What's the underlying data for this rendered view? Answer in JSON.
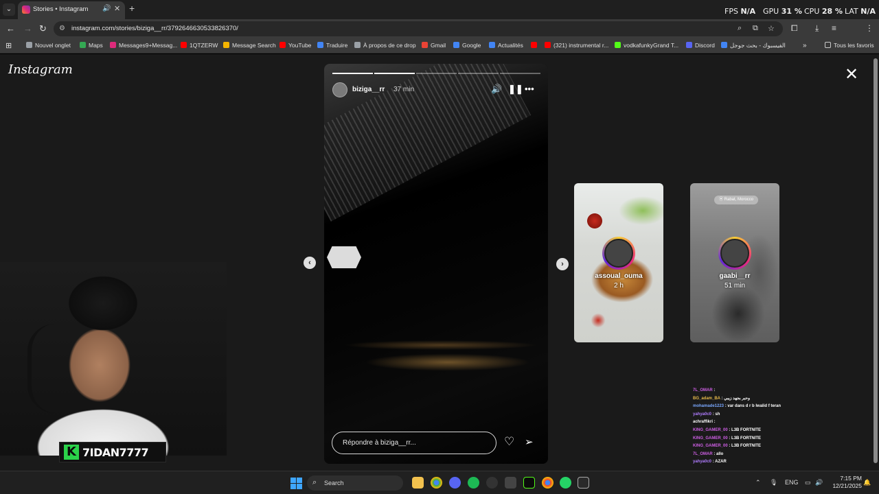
{
  "browser": {
    "tab": {
      "title": "Stories • Instagram"
    },
    "url": "instagram.com/stories/biziga__rr/3792646630533826370/",
    "bookmarks": [
      {
        "label": "Nouvel onglet",
        "icon": "globe-icon",
        "color": "#9aa0a6"
      },
      {
        "label": "Maps",
        "icon": "maps-icon",
        "color": "#34a853"
      },
      {
        "label": "Messages9+Messag...",
        "icon": "instagram-icon",
        "color": "#dd2a7b"
      },
      {
        "label": "1QTZERW",
        "icon": "youtube-icon",
        "color": "#ff0000"
      },
      {
        "label": "Message Search",
        "icon": "bars-icon",
        "color": "#f4b400"
      },
      {
        "label": "YouTube",
        "icon": "youtube-icon",
        "color": "#ff0000"
      },
      {
        "label": "Traduire",
        "icon": "translate-icon",
        "color": "#4285f4"
      },
      {
        "label": "À propos de ce drop",
        "icon": "globe-icon",
        "color": "#9aa0a6"
      },
      {
        "label": "Gmail",
        "icon": "gmail-icon",
        "color": "#ea4335"
      },
      {
        "label": "Google",
        "icon": "google-icon",
        "color": "#4285f4"
      },
      {
        "label": "Actualités",
        "icon": "news-icon",
        "color": "#4285f4"
      },
      {
        "label": "",
        "icon": "youtube-icon",
        "color": "#ff0000"
      },
      {
        "label": "(321) instrumental r...",
        "icon": "youtube-icon",
        "color": "#ff0000"
      },
      {
        "label": "vodkafunkyGrand T...",
        "icon": "kick-icon",
        "color": "#53fc18"
      },
      {
        "label": "Discord",
        "icon": "discord-icon",
        "color": "#5865f2"
      },
      {
        "label": "الفيسبوك - بحث جوجل",
        "icon": "google-icon",
        "color": "#4285f4"
      }
    ],
    "all_bookmarks": "Tous les favoris"
  },
  "hud": {
    "fps_label": "FPS",
    "fps_value": "N/A",
    "gpu_label": "GPU",
    "gpu_value": "31 %",
    "cpu_label": "CPU",
    "cpu_value": "28 %",
    "lat_label": "LAT",
    "lat_value": "N/A"
  },
  "instagram": {
    "logo": "Instagram",
    "story": {
      "username": "biziga__rr",
      "time": "37 min",
      "progress_segments": 5,
      "segments_done": 2,
      "reply_placeholder": "Répondre à biziga__rr..."
    },
    "next_stories": [
      {
        "username": "assoual_ouma",
        "time": "2 h"
      },
      {
        "username": "gaabi__rr",
        "time": "51 min",
        "location": "Rabat, Morocco"
      }
    ]
  },
  "chat": [
    {
      "user": "7L_OMAR",
      "msg": "",
      "color": "#cf5fe6"
    },
    {
      "user": "BG_adam_BA",
      "msg": "وحبر بجهد زيبي",
      "color": "#e5b94a"
    },
    {
      "user": "mohamade1223",
      "msg": "var dans d r b lwalid f teran",
      "color": "#7aa8ff"
    },
    {
      "user": "yahya0c0",
      "msg": "sh",
      "color": "#b07cff"
    },
    {
      "user": "achraffikri",
      "msg": "",
      "color": "#ffffff"
    },
    {
      "user": "KING_GAMER_00",
      "msg": "L3B FORTNITE",
      "color": "#cf5fe6"
    },
    {
      "user": "KING_GAMER_00",
      "msg": "L3B FORTNITE",
      "color": "#cf5fe6"
    },
    {
      "user": "KING_GAMER_00",
      "msg": "L3B FORTNITE",
      "color": "#cf5fe6"
    },
    {
      "user": "7L_OMAR",
      "msg": "allo",
      "color": "#cf5fe6"
    },
    {
      "user": "yahya0c0",
      "msg": "AZAR",
      "color": "#b07cff"
    }
  ],
  "streamer": {
    "name": "7IDAN7777",
    "k": "K"
  },
  "taskbar": {
    "search": "Search",
    "language": "ENG",
    "time": "7:15 PM",
    "date": "12/21/2025"
  }
}
